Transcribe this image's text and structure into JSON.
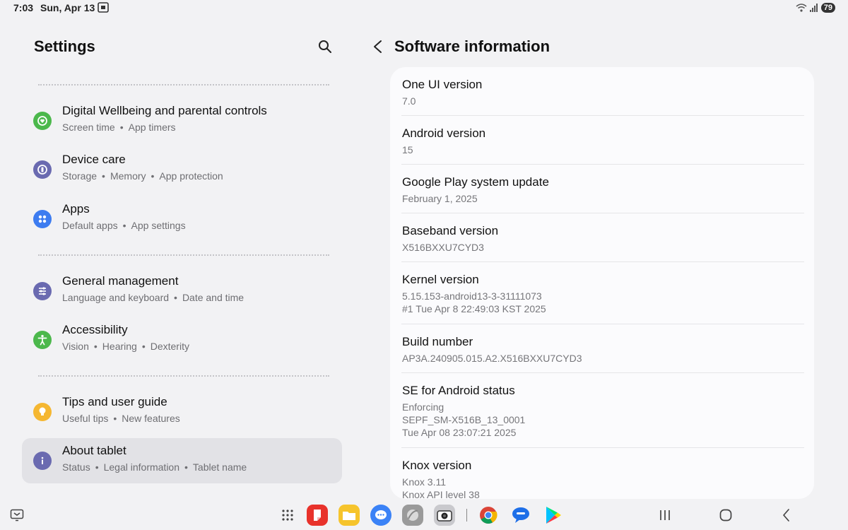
{
  "status_bar": {
    "time": "7:03",
    "date": "Sun, Apr 13",
    "battery": "79"
  },
  "left": {
    "title": "Settings",
    "items": [
      {
        "title": "Digital Wellbeing and parental controls",
        "subs": [
          "Screen time",
          "App timers"
        ],
        "icon": "wellbeing-icon",
        "color": "#4cb84c"
      },
      {
        "title": "Device care",
        "subs": [
          "Storage",
          "Memory",
          "App protection"
        ],
        "icon": "device-care-icon",
        "color": "#6a6ab0"
      },
      {
        "title": "Apps",
        "subs": [
          "Default apps",
          "App settings"
        ],
        "icon": "apps-icon",
        "color": "#3d7cf0"
      },
      {
        "title": "General management",
        "subs": [
          "Language and keyboard",
          "Date and time"
        ],
        "icon": "general-management-icon",
        "color": "#6a6ab0"
      },
      {
        "title": "Accessibility",
        "subs": [
          "Vision",
          "Hearing",
          "Dexterity"
        ],
        "icon": "accessibility-icon",
        "color": "#4cb84c"
      },
      {
        "title": "Tips and user guide",
        "subs": [
          "Useful tips",
          "New features"
        ],
        "icon": "tips-icon",
        "color": "#f5b731"
      },
      {
        "title": "About tablet",
        "subs": [
          "Status",
          "Legal information",
          "Tablet name"
        ],
        "icon": "info-icon",
        "color": "#6a6ab0"
      }
    ]
  },
  "right": {
    "title": "Software information",
    "rows": [
      {
        "title": "One UI version",
        "values": [
          "7.0"
        ]
      },
      {
        "title": "Android version",
        "values": [
          "15"
        ]
      },
      {
        "title": "Google Play system update",
        "values": [
          "February 1, 2025"
        ]
      },
      {
        "title": "Baseband version",
        "values": [
          "X516BXXU7CYD3"
        ]
      },
      {
        "title": "Kernel version",
        "values": [
          "5.15.153-android13-3-31111073",
          "#1 Tue Apr 8 22:49:03 KST 2025"
        ]
      },
      {
        "title": "Build number",
        "values": [
          "AP3A.240905.015.A2.X516BXXU7CYD3"
        ]
      },
      {
        "title": "SE for Android status",
        "values": [
          "Enforcing",
          "SEPF_SM-X516B_13_0001",
          "Tue Apr 08 23:07:21 2025"
        ]
      },
      {
        "title": "Knox version",
        "values": [
          "Knox 3.11",
          "Knox API level 38"
        ]
      }
    ]
  },
  "dock": {
    "apps": [
      {
        "name": "app-drawer-icon"
      },
      {
        "name": "samsung-notes-icon",
        "color": "#e8322b"
      },
      {
        "name": "my-files-icon",
        "color": "#f6c42c"
      },
      {
        "name": "messages-icon",
        "color": "#3b82f6"
      },
      {
        "name": "samsung-internet-icon",
        "color": "#9a9a9a"
      },
      {
        "name": "camera-icon",
        "color": "#a0a0a4"
      },
      {
        "name": "chrome-icon"
      },
      {
        "name": "chat-icon",
        "color": "#1e6fe8"
      },
      {
        "name": "play-store-icon"
      }
    ]
  }
}
